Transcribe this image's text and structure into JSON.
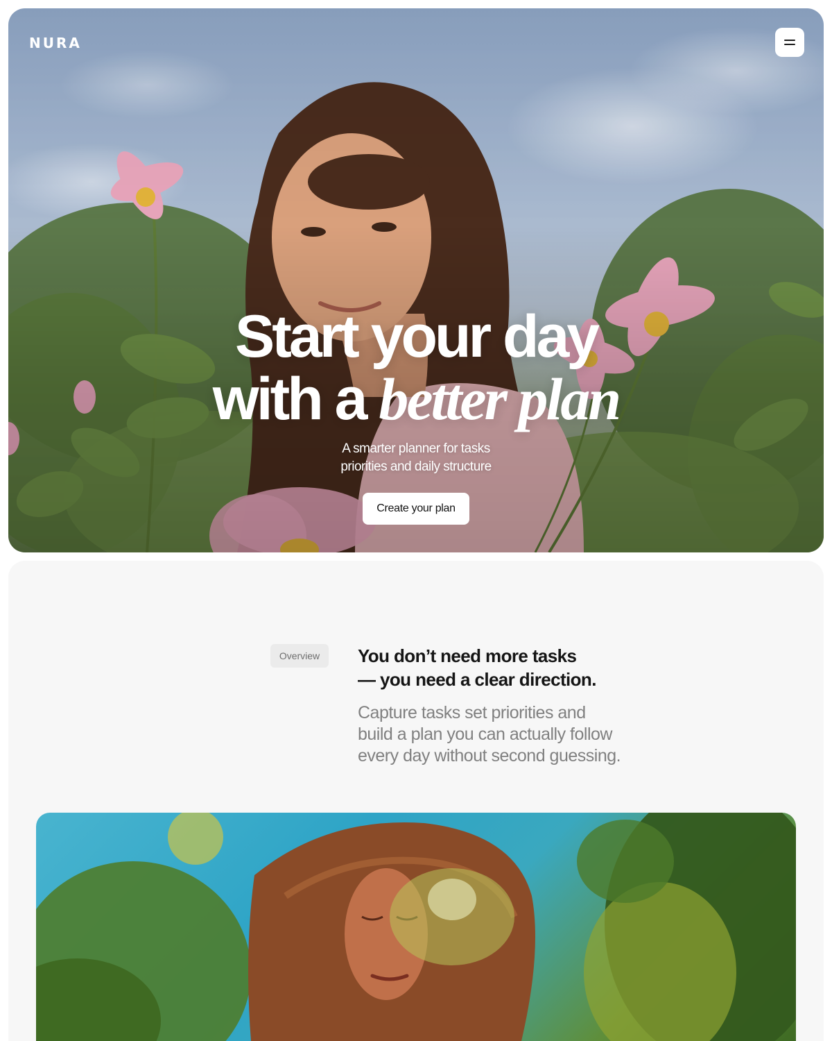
{
  "header": {
    "brand": "NURA",
    "menu_icon": "hamburger-icon"
  },
  "hero": {
    "title_line1": "Start your day",
    "title_line2_prefix": "with a ",
    "title_line2_accent": "better plan",
    "subtitle_line1": "A smarter planner for tasks",
    "subtitle_line2": "priorities and daily structure",
    "cta_label": "Create your plan"
  },
  "overview": {
    "tag": "Overview",
    "heading_line1": "You don’t need more tasks",
    "heading_line2": "— you need a clear direction.",
    "body_line1": "Capture tasks set priorities and",
    "body_line2": "build a plan you can actually follow",
    "body_line3": "every day without second guessing."
  },
  "colors": {
    "overview_bg": "#f7f7f7",
    "tag_bg": "#ebebeb",
    "heading": "#151515",
    "body": "#808080",
    "cta_bg": "#ffffff"
  }
}
